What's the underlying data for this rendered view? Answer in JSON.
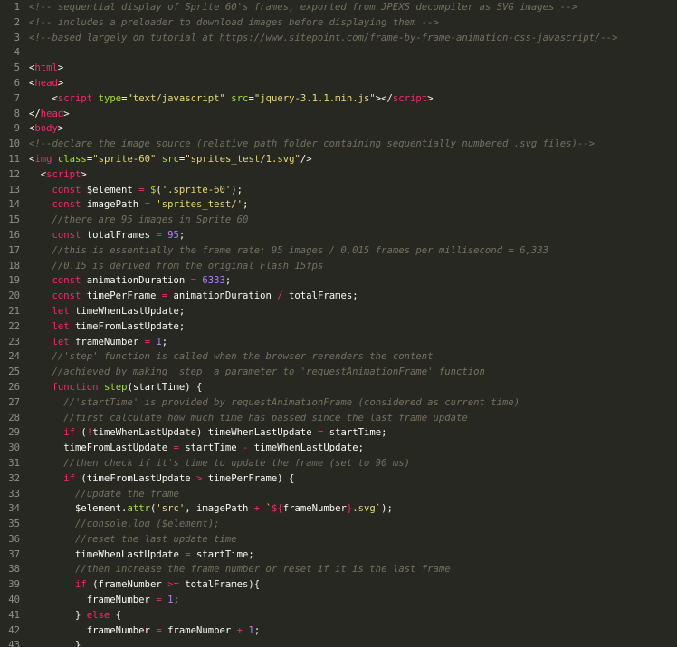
{
  "editor": {
    "lines": [
      {
        "n": "1",
        "tokens": [
          {
            "t": "<!-- sequential display of Sprite 60's frames, exported from JPEXS decompiler as SVG images -->",
            "c": "cm"
          }
        ]
      },
      {
        "n": "2",
        "tokens": [
          {
            "t": "<!-- includes a preloader to download images before displaying them -->",
            "c": "cm"
          }
        ]
      },
      {
        "n": "3",
        "tokens": [
          {
            "t": "<!--based largely on tutorial at https://www.sitepoint.com/frame-by-frame-animation-css-javascript/-->",
            "c": "cm"
          }
        ]
      },
      {
        "n": "4",
        "tokens": []
      },
      {
        "n": "5",
        "tokens": [
          {
            "t": "<",
            "c": "pl"
          },
          {
            "t": "html",
            "c": "tag"
          },
          {
            "t": ">",
            "c": "pl"
          }
        ]
      },
      {
        "n": "6",
        "tokens": [
          {
            "t": "<",
            "c": "pl"
          },
          {
            "t": "head",
            "c": "tag"
          },
          {
            "t": ">",
            "c": "pl"
          }
        ]
      },
      {
        "n": "7",
        "tokens": [
          {
            "t": "    <",
            "c": "pl"
          },
          {
            "t": "script",
            "c": "tag"
          },
          {
            "t": " ",
            "c": "pl"
          },
          {
            "t": "type",
            "c": "attr"
          },
          {
            "t": "=",
            "c": "pl"
          },
          {
            "t": "\"text/javascript\"",
            "c": "str"
          },
          {
            "t": " ",
            "c": "pl"
          },
          {
            "t": "src",
            "c": "attr"
          },
          {
            "t": "=",
            "c": "pl"
          },
          {
            "t": "\"jquery-3.1.1.min.js\"",
            "c": "str"
          },
          {
            "t": "></",
            "c": "pl"
          },
          {
            "t": "script",
            "c": "tag"
          },
          {
            "t": ">",
            "c": "pl"
          }
        ]
      },
      {
        "n": "8",
        "tokens": [
          {
            "t": "</",
            "c": "pl"
          },
          {
            "t": "head",
            "c": "tag"
          },
          {
            "t": ">",
            "c": "pl"
          }
        ]
      },
      {
        "n": "9",
        "tokens": [
          {
            "t": "<",
            "c": "pl"
          },
          {
            "t": "body",
            "c": "tag"
          },
          {
            "t": ">",
            "c": "pl"
          }
        ]
      },
      {
        "n": "10",
        "tokens": [
          {
            "t": "<!--declare the image source (relative path folder containing sequentially numbered .svg files)-->",
            "c": "cm"
          }
        ]
      },
      {
        "n": "11",
        "tokens": [
          {
            "t": "<",
            "c": "pl"
          },
          {
            "t": "img",
            "c": "tag"
          },
          {
            "t": " ",
            "c": "pl"
          },
          {
            "t": "class",
            "c": "attr"
          },
          {
            "t": "=",
            "c": "pl"
          },
          {
            "t": "\"sprite-60\"",
            "c": "str"
          },
          {
            "t": " ",
            "c": "pl"
          },
          {
            "t": "src",
            "c": "attr"
          },
          {
            "t": "=",
            "c": "pl"
          },
          {
            "t": "\"sprites_test/1.svg\"",
            "c": "str"
          },
          {
            "t": "/>",
            "c": "pl"
          }
        ]
      },
      {
        "n": "12",
        "tokens": [
          {
            "t": "  <",
            "c": "pl"
          },
          {
            "t": "script",
            "c": "tag"
          },
          {
            "t": ">",
            "c": "pl"
          }
        ]
      },
      {
        "n": "13",
        "tokens": [
          {
            "t": "    ",
            "c": "pl"
          },
          {
            "t": "const",
            "c": "kw"
          },
          {
            "t": " $element ",
            "c": "pl"
          },
          {
            "t": "=",
            "c": "op"
          },
          {
            "t": " ",
            "c": "pl"
          },
          {
            "t": "$",
            "c": "fn"
          },
          {
            "t": "(",
            "c": "pl"
          },
          {
            "t": "'.sprite-60'",
            "c": "str"
          },
          {
            "t": ");",
            "c": "pl"
          }
        ]
      },
      {
        "n": "14",
        "tokens": [
          {
            "t": "    ",
            "c": "pl"
          },
          {
            "t": "const",
            "c": "kw"
          },
          {
            "t": " imagePath ",
            "c": "pl"
          },
          {
            "t": "=",
            "c": "op"
          },
          {
            "t": " ",
            "c": "pl"
          },
          {
            "t": "'sprites_test/'",
            "c": "str"
          },
          {
            "t": ";",
            "c": "pl"
          }
        ]
      },
      {
        "n": "15",
        "tokens": [
          {
            "t": "    ",
            "c": "pl"
          },
          {
            "t": "//there are 95 images in Sprite 60",
            "c": "cm"
          }
        ]
      },
      {
        "n": "16",
        "tokens": [
          {
            "t": "    ",
            "c": "pl"
          },
          {
            "t": "const",
            "c": "kw"
          },
          {
            "t": " totalFrames ",
            "c": "pl"
          },
          {
            "t": "=",
            "c": "op"
          },
          {
            "t": " ",
            "c": "pl"
          },
          {
            "t": "95",
            "c": "num"
          },
          {
            "t": ";",
            "c": "pl"
          }
        ]
      },
      {
        "n": "17",
        "tokens": [
          {
            "t": "    ",
            "c": "pl"
          },
          {
            "t": "//this is essentially the frame rate: 95 images / 0.015 frames per millisecond = 6,333",
            "c": "cm"
          }
        ]
      },
      {
        "n": "18",
        "tokens": [
          {
            "t": "    ",
            "c": "pl"
          },
          {
            "t": "//0.15 is derived from the original Flash 15fps",
            "c": "cm"
          }
        ]
      },
      {
        "n": "19",
        "tokens": [
          {
            "t": "    ",
            "c": "pl"
          },
          {
            "t": "const",
            "c": "kw"
          },
          {
            "t": " animationDuration ",
            "c": "pl"
          },
          {
            "t": "=",
            "c": "op"
          },
          {
            "t": " ",
            "c": "pl"
          },
          {
            "t": "6333",
            "c": "num"
          },
          {
            "t": ";",
            "c": "pl"
          }
        ]
      },
      {
        "n": "20",
        "tokens": [
          {
            "t": "    ",
            "c": "pl"
          },
          {
            "t": "const",
            "c": "kw"
          },
          {
            "t": " timePerFrame ",
            "c": "pl"
          },
          {
            "t": "=",
            "c": "op"
          },
          {
            "t": " animationDuration ",
            "c": "pl"
          },
          {
            "t": "/",
            "c": "op"
          },
          {
            "t": " totalFrames;",
            "c": "pl"
          }
        ]
      },
      {
        "n": "21",
        "tokens": [
          {
            "t": "    ",
            "c": "pl"
          },
          {
            "t": "let",
            "c": "kw"
          },
          {
            "t": " timeWhenLastUpdate;",
            "c": "pl"
          }
        ]
      },
      {
        "n": "22",
        "tokens": [
          {
            "t": "    ",
            "c": "pl"
          },
          {
            "t": "let",
            "c": "kw"
          },
          {
            "t": " timeFromLastUpdate;",
            "c": "pl"
          }
        ]
      },
      {
        "n": "23",
        "tokens": [
          {
            "t": "    ",
            "c": "pl"
          },
          {
            "t": "let",
            "c": "kw"
          },
          {
            "t": " frameNumber ",
            "c": "pl"
          },
          {
            "t": "=",
            "c": "op"
          },
          {
            "t": " ",
            "c": "pl"
          },
          {
            "t": "1",
            "c": "num"
          },
          {
            "t": ";",
            "c": "pl"
          }
        ]
      },
      {
        "n": "24",
        "tokens": [
          {
            "t": "    ",
            "c": "pl"
          },
          {
            "t": "//'step' function is called when the browser rerenders the content",
            "c": "cm"
          }
        ]
      },
      {
        "n": "25",
        "tokens": [
          {
            "t": "    ",
            "c": "pl"
          },
          {
            "t": "//achieved by making 'step' a parameter to 'requestAnimationFrame' function",
            "c": "cm"
          }
        ]
      },
      {
        "n": "26",
        "tokens": [
          {
            "t": "    ",
            "c": "pl"
          },
          {
            "t": "function",
            "c": "kw"
          },
          {
            "t": " ",
            "c": "pl"
          },
          {
            "t": "step",
            "c": "fn"
          },
          {
            "t": "(startTime) {",
            "c": "pl"
          }
        ]
      },
      {
        "n": "27",
        "tokens": [
          {
            "t": "      ",
            "c": "pl"
          },
          {
            "t": "//'startTime' is provided by requestAnimationFrame (considered as current time)",
            "c": "cm"
          }
        ]
      },
      {
        "n": "28",
        "tokens": [
          {
            "t": "      ",
            "c": "pl"
          },
          {
            "t": "//first calculate how much time has passed since the last frame update",
            "c": "cm"
          }
        ]
      },
      {
        "n": "29",
        "tokens": [
          {
            "t": "      ",
            "c": "pl"
          },
          {
            "t": "if",
            "c": "kw"
          },
          {
            "t": " (",
            "c": "pl"
          },
          {
            "t": "!",
            "c": "op"
          },
          {
            "t": "timeWhenLastUpdate) timeWhenLastUpdate ",
            "c": "pl"
          },
          {
            "t": "=",
            "c": "op"
          },
          {
            "t": " startTime;",
            "c": "pl"
          }
        ]
      },
      {
        "n": "30",
        "tokens": [
          {
            "t": "      timeFromLastUpdate ",
            "c": "pl"
          },
          {
            "t": "=",
            "c": "op"
          },
          {
            "t": " startTime ",
            "c": "pl"
          },
          {
            "t": "-",
            "c": "op"
          },
          {
            "t": " timeWhenLastUpdate;",
            "c": "pl"
          }
        ]
      },
      {
        "n": "31",
        "tokens": [
          {
            "t": "      ",
            "c": "pl"
          },
          {
            "t": "//then check if it's time to update the frame (set to 90 ms)",
            "c": "cm"
          }
        ]
      },
      {
        "n": "32",
        "tokens": [
          {
            "t": "      ",
            "c": "pl"
          },
          {
            "t": "if",
            "c": "kw"
          },
          {
            "t": " (timeFromLastUpdate ",
            "c": "pl"
          },
          {
            "t": ">",
            "c": "op"
          },
          {
            "t": " timePerFrame) {",
            "c": "pl"
          }
        ]
      },
      {
        "n": "33",
        "tokens": [
          {
            "t": "        ",
            "c": "pl"
          },
          {
            "t": "//update the frame",
            "c": "cm"
          }
        ]
      },
      {
        "n": "34",
        "tokens": [
          {
            "t": "        $element.",
            "c": "pl"
          },
          {
            "t": "attr",
            "c": "fn"
          },
          {
            "t": "(",
            "c": "pl"
          },
          {
            "t": "'src'",
            "c": "str"
          },
          {
            "t": ", imagePath ",
            "c": "pl"
          },
          {
            "t": "+",
            "c": "op"
          },
          {
            "t": " ",
            "c": "pl"
          },
          {
            "t": "`",
            "c": "str"
          },
          {
            "t": "${",
            "c": "tag"
          },
          {
            "t": "frameNumber",
            "c": "pl"
          },
          {
            "t": "}",
            "c": "tag"
          },
          {
            "t": ".svg`",
            "c": "str"
          },
          {
            "t": ");",
            "c": "pl"
          }
        ]
      },
      {
        "n": "35",
        "tokens": [
          {
            "t": "        ",
            "c": "pl"
          },
          {
            "t": "//console.log ($element);",
            "c": "cm"
          }
        ]
      },
      {
        "n": "36",
        "tokens": [
          {
            "t": "        ",
            "c": "pl"
          },
          {
            "t": "//reset the last update time",
            "c": "cm"
          }
        ]
      },
      {
        "n": "37",
        "tokens": [
          {
            "t": "        timeWhenLastUpdate ",
            "c": "pl"
          },
          {
            "t": "=",
            "c": "op"
          },
          {
            "t": " startTime;",
            "c": "pl"
          }
        ]
      },
      {
        "n": "38",
        "tokens": [
          {
            "t": "        ",
            "c": "pl"
          },
          {
            "t": "//then increase the frame number or reset if it is the last frame",
            "c": "cm"
          }
        ]
      },
      {
        "n": "39",
        "tokens": [
          {
            "t": "        ",
            "c": "pl"
          },
          {
            "t": "if",
            "c": "kw"
          },
          {
            "t": " (frameNumber ",
            "c": "pl"
          },
          {
            "t": ">=",
            "c": "op"
          },
          {
            "t": " totalFrames){",
            "c": "pl"
          }
        ]
      },
      {
        "n": "40",
        "tokens": [
          {
            "t": "          frameNumber ",
            "c": "pl"
          },
          {
            "t": "=",
            "c": "op"
          },
          {
            "t": " ",
            "c": "pl"
          },
          {
            "t": "1",
            "c": "num"
          },
          {
            "t": ";",
            "c": "pl"
          }
        ]
      },
      {
        "n": "41",
        "tokens": [
          {
            "t": "        } ",
            "c": "pl"
          },
          {
            "t": "else",
            "c": "kw"
          },
          {
            "t": " {",
            "c": "pl"
          }
        ]
      },
      {
        "n": "42",
        "tokens": [
          {
            "t": "          frameNumber ",
            "c": "pl"
          },
          {
            "t": "=",
            "c": "op"
          },
          {
            "t": " frameNumber ",
            "c": "pl"
          },
          {
            "t": "+",
            "c": "op"
          },
          {
            "t": " ",
            "c": "pl"
          },
          {
            "t": "1",
            "c": "num"
          },
          {
            "t": ";",
            "c": "pl"
          }
        ]
      },
      {
        "n": "43",
        "tokens": [
          {
            "t": "        }",
            "c": "pl"
          }
        ]
      }
    ]
  }
}
